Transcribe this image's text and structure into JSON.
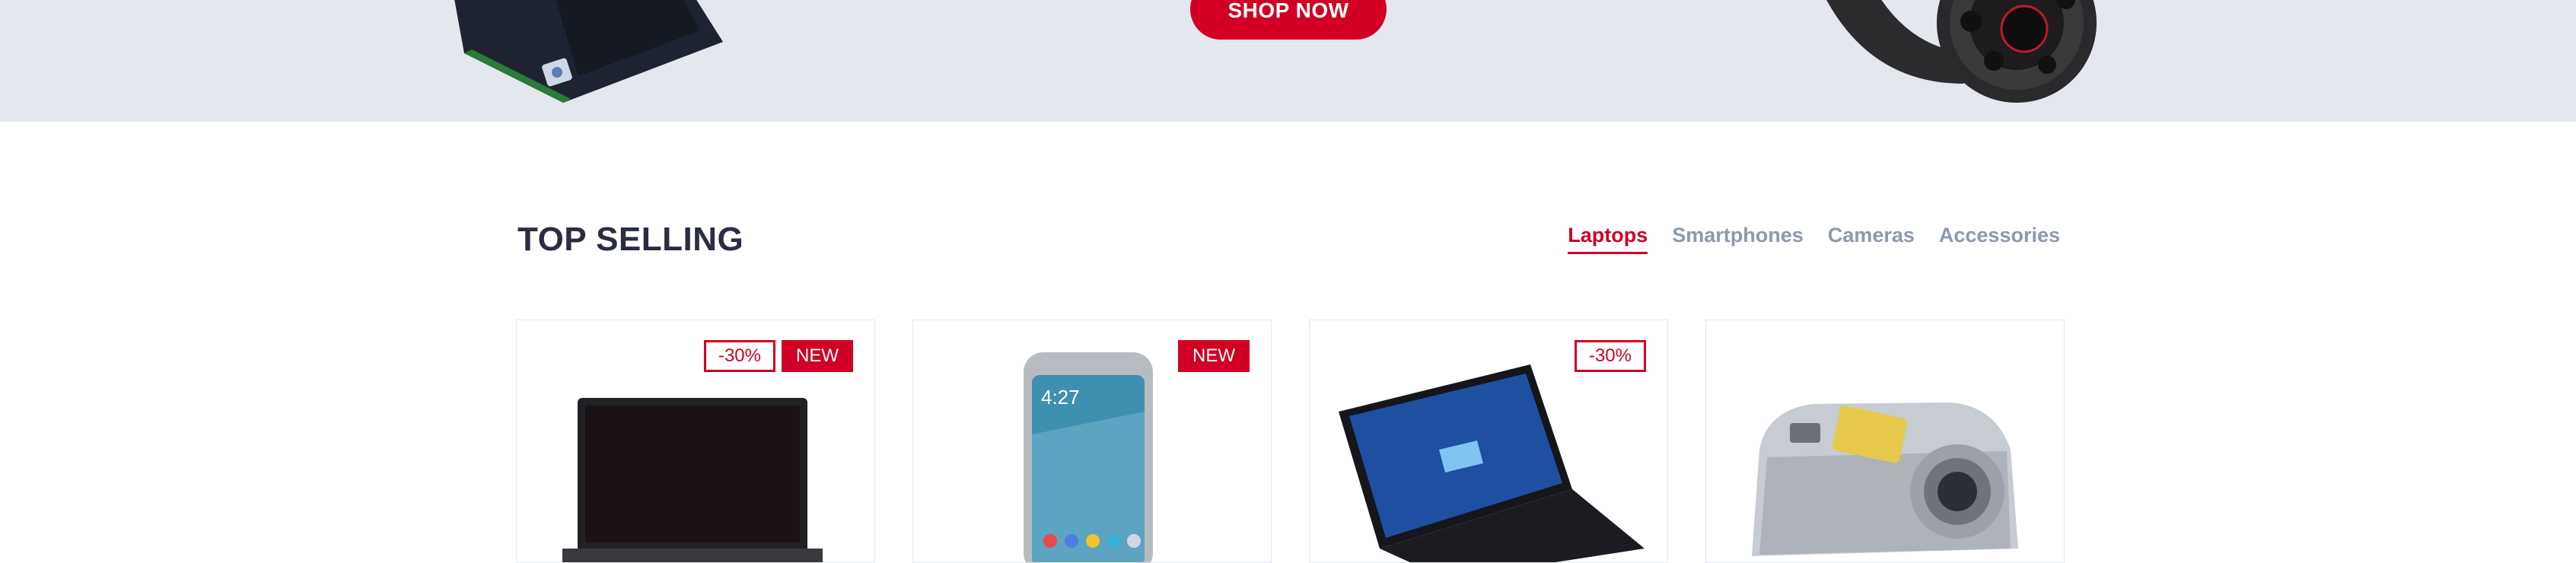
{
  "hero": {
    "shop_now_label": "SHOP NOW"
  },
  "section": {
    "title": "TOP SELLING",
    "tabs": [
      {
        "label": "Laptops",
        "active": true
      },
      {
        "label": "Smartphones",
        "active": false
      },
      {
        "label": "Cameras",
        "active": false
      },
      {
        "label": "Accessories",
        "active": false
      }
    ]
  },
  "products": [
    {
      "image": "laptop-dark",
      "labels": {
        "sale": "-30%",
        "new": "NEW"
      }
    },
    {
      "image": "smartphone",
      "labels": {
        "new": "NEW"
      }
    },
    {
      "image": "laptop-windows",
      "labels": {
        "sale": "-30%"
      }
    },
    {
      "image": "camera",
      "labels": {}
    }
  ],
  "colors": {
    "primary": "#d10024",
    "heading": "#2b2d42",
    "muted": "#8d99ae",
    "hero_bg": "#e4e7ed"
  }
}
